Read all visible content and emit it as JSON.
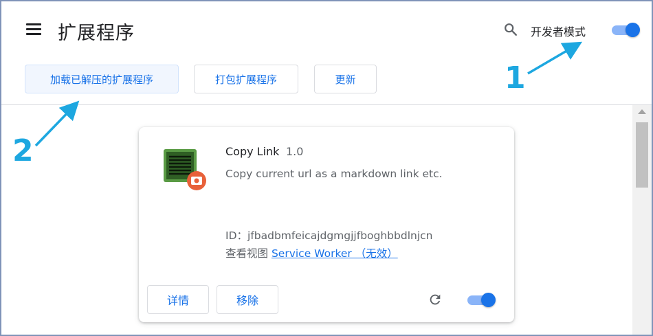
{
  "header": {
    "title": "扩展程序",
    "menu_icon": "hamburger-menu-icon",
    "search_icon": "search-icon",
    "developer_mode_label": "开发者模式",
    "developer_mode_on": true
  },
  "toolbar": {
    "load_unpacked_label": "加载已解压的扩展程序",
    "pack_label": "打包扩展程序",
    "update_label": "更新"
  },
  "extension": {
    "name": "Copy Link",
    "version": "1.0",
    "description": "Copy current url as a markdown link etc.",
    "id_text": "ID：jfbadbmfeicajdgmgjjfboghbbdlnjcn",
    "views_label": "查看视图",
    "views_link": "Service Worker （无效）",
    "details_label": "详情",
    "remove_label": "移除",
    "enabled": true
  },
  "annotations": {
    "label_1": "1",
    "label_2": "2"
  },
  "colors": {
    "accent": "#1a73e8",
    "toggle_track": "#8ab4f8",
    "annotation": "#1da7e0"
  }
}
